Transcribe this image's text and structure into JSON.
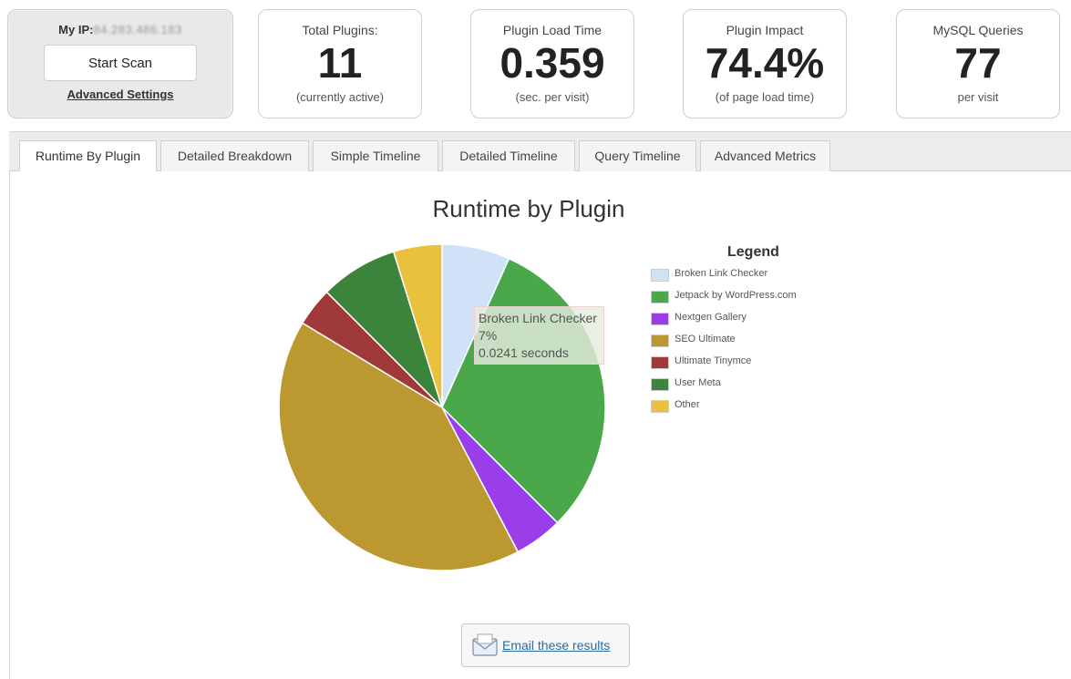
{
  "scan": {
    "ip_label": "My IP:",
    "ip_value": "84.283.486.183",
    "start_button": "Start Scan",
    "advanced_link": "Advanced Settings"
  },
  "stats": [
    {
      "label": "Total Plugins:",
      "value": "11",
      "sub": "(currently active)"
    },
    {
      "label": "Plugin Load Time",
      "value": "0.359",
      "sub": "(sec. per visit)"
    },
    {
      "label": "Plugin Impact",
      "value": "74.4%",
      "sub": "(of page load time)"
    },
    {
      "label": "MySQL Queries",
      "value": "77",
      "sub": "per visit"
    }
  ],
  "tabs": [
    {
      "label": "Runtime By Plugin",
      "active": true
    },
    {
      "label": "Detailed Breakdown",
      "active": false
    },
    {
      "label": "Simple Timeline",
      "active": false
    },
    {
      "label": "Detailed Timeline",
      "active": false
    },
    {
      "label": "Query Timeline",
      "active": false
    },
    {
      "label": "Advanced Metrics",
      "active": false
    }
  ],
  "chart_data": {
    "type": "pie",
    "title": "Runtime by Plugin",
    "legend_title": "Legend",
    "legend_position": "right",
    "categories": [
      "Broken Link Checker",
      "Jetpack by WordPress.com",
      "Nextgen Gallery",
      "SEO Ultimate",
      "Ultimate Tinymce",
      "User Meta",
      "Other"
    ],
    "values": [
      7,
      32,
      5,
      43,
      4,
      8,
      5
    ],
    "colors": [
      "#cfe2f7",
      "#4aa84a",
      "#9a3ee9",
      "#bb9930",
      "#a03a3a",
      "#3c843c",
      "#eac13e"
    ]
  },
  "tooltip": {
    "line1": "Broken Link Checker",
    "line2": "7%",
    "line3": "0.0241 seconds"
  },
  "email_button": {
    "label": "Email these results",
    "icon": "envelope-icon"
  }
}
